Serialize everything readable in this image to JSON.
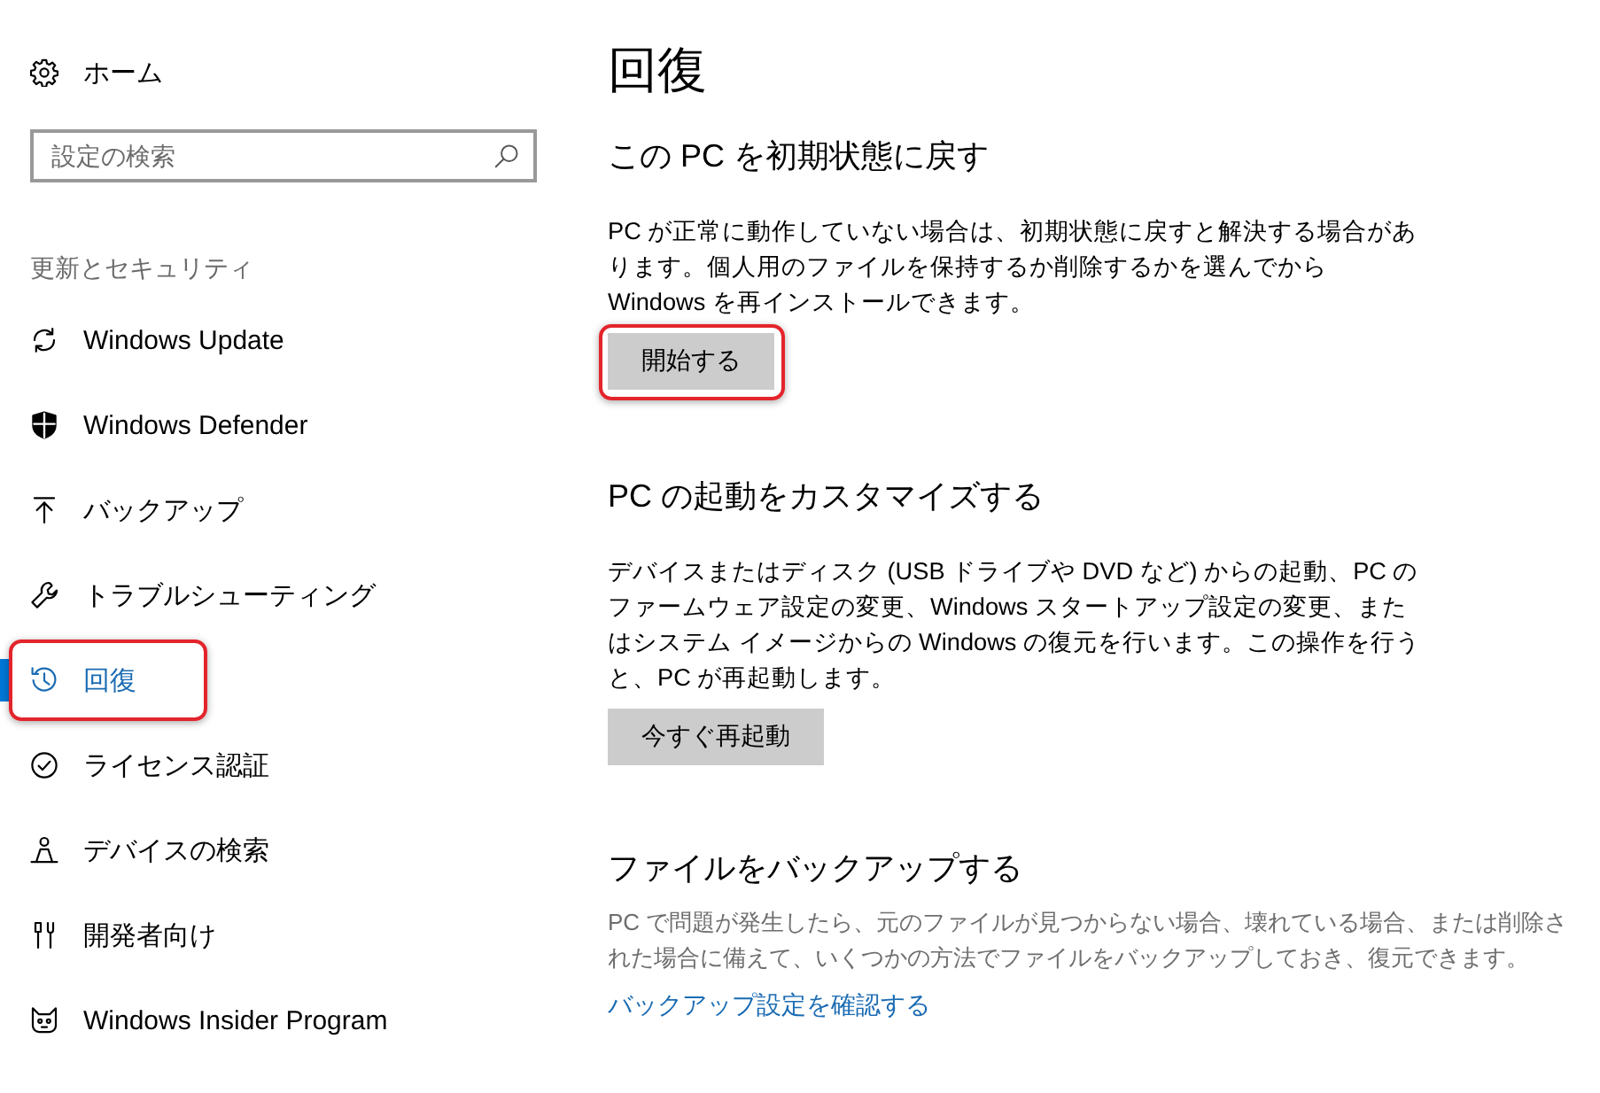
{
  "sidebar": {
    "home": {
      "label": "ホーム"
    },
    "search": {
      "placeholder": "設定の検索"
    },
    "group_title": "更新とセキュリティ",
    "items": [
      {
        "label": "Windows Update",
        "selected": false,
        "highlighted": false
      },
      {
        "label": "Windows Defender",
        "selected": false,
        "highlighted": false
      },
      {
        "label": "バックアップ",
        "selected": false,
        "highlighted": false
      },
      {
        "label": "トラブルシューティング",
        "selected": false,
        "highlighted": false
      },
      {
        "label": "回復",
        "selected": true,
        "highlighted": true
      },
      {
        "label": "ライセンス認証",
        "selected": false,
        "highlighted": false
      },
      {
        "label": "デバイスの検索",
        "selected": false,
        "highlighted": false
      },
      {
        "label": "開発者向け",
        "selected": false,
        "highlighted": false
      },
      {
        "label": "Windows Insider Program",
        "selected": false,
        "highlighted": false
      }
    ]
  },
  "page": {
    "title": "回復"
  },
  "sections": [
    {
      "kind": "button",
      "heading": "この PC を初期状態に戻す",
      "text": "PC が正常に動作していない場合は、初期状態に戻すと解決する場合があります。個人用のファイルを保持するか削除するかを選んでから Windows を再インストールできます。",
      "button": {
        "label": "開始する",
        "highlighted": true
      }
    },
    {
      "kind": "button",
      "heading": "PC の起動をカスタマイズする",
      "text": "デバイスまたはディスク (USB ドライブや DVD など) からの起動、PC のファームウェア設定の変更、Windows スタートアップ設定の変更、またはシステム イメージからの Windows の復元を行います。この操作を行うと、PC が再起動します。",
      "button": {
        "label": "今すぐ再起動",
        "highlighted": false
      }
    },
    {
      "kind": "link",
      "heading": "ファイルをバックアップする",
      "text": "PC で問題が発生したら、元のファイルが見つからない場合、壊れている場合、または削除された場合に備えて、いくつかの方法でファイルをバックアップしておき、復元できます。",
      "link": "バックアップ設定を確認する"
    }
  ]
}
